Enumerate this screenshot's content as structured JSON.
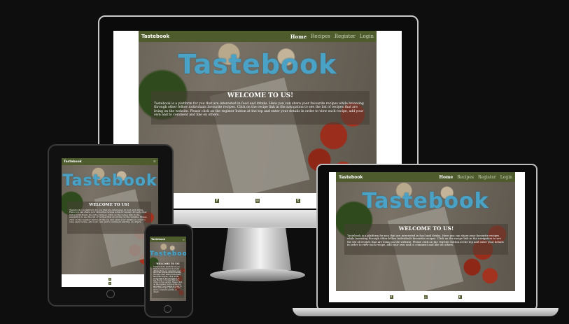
{
  "site": {
    "brand": "Tastebook",
    "nav": [
      {
        "label": "Home",
        "active": true
      },
      {
        "label": "Recipes",
        "active": false
      },
      {
        "label": "Register",
        "active": false
      },
      {
        "label": "Login",
        "active": false
      }
    ],
    "logo_text": "Tastebook",
    "welcome_title": "WELCOME TO US!",
    "welcome_text": "Tastebook is a platform for you that are interested in food and drinks. Here you can share your favourite recipes while browsing through other fellow individuals favourite recipes. Click on the recipe link in the navigation to see the list of recipes that are living on the website. Please click on the register button at the top and enter your details in order to view each recipe, add your own and to comment and like on others.",
    "footer_icons": [
      "facebook-icon",
      "instagram-icon",
      "twitter-icon"
    ]
  },
  "colors": {
    "nav_bg": "#4e5b2c",
    "logo": "#4aa3c7",
    "background": "#0e0e0f"
  }
}
